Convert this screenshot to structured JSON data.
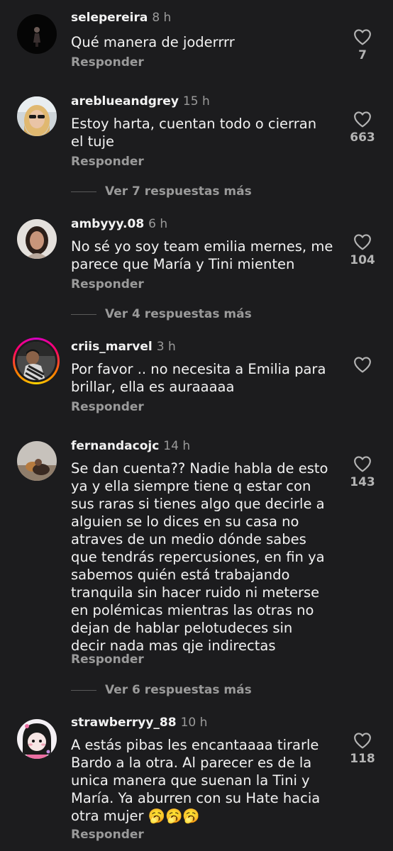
{
  "comments": [
    {
      "username": "selepereira",
      "time": "8 h",
      "lines": [
        "Qué manera de joderrrr"
      ],
      "reply": "Responder",
      "likes": "7"
    },
    {
      "username": "areblueandgrey",
      "time": "15 h",
      "lines": [
        "Estoy harta, cuentan todo o cierran",
        "el tuje"
      ],
      "reply": "Responder",
      "likes": "663",
      "more_replies": "Ver 7 respuestas más"
    },
    {
      "username": "ambyyy.08",
      "time": "6 h",
      "lines": [
        "No sé yo soy team emilia mernes, me",
        "parece que María y Tini mienten"
      ],
      "reply": "Responder",
      "likes": "104",
      "more_replies": "Ver 4 respuestas más"
    },
    {
      "username": "criis_marvel",
      "time": "3 h",
      "lines": [
        "Por favor .. no necesita a Emilia para",
        "brillar, ella es auraaaaa"
      ],
      "reply": "Responder",
      "likes": ""
    },
    {
      "username": "fernandacojc",
      "time": "14 h",
      "lines": [
        "Se dan cuenta?? Nadie habla de esto",
        "ya y ella siempre tiene q estar con",
        "sus raras si tienes algo que decirle a",
        "alguien se lo dices en su casa no",
        "atraves de un medio dónde sabes",
        "que tendrás repercusiones, en fin ya",
        "sabemos quién está trabajando",
        "tranquila sin hacer ruido ni meterse",
        "en polémicas mientras las otras no",
        "dejan de hablar pelotudeces sin",
        "decir nada mas qje indirectas"
      ],
      "reply": "Responder",
      "likes": "143",
      "more_replies": "Ver 6 respuestas más"
    },
    {
      "username": "strawberryy_88",
      "time": "10 h",
      "lines": [
        "A estás pibas les encantaaaa tirarle",
        "Bardo a la otra. Al parecer es de la",
        "unica manera que suenan la Tini y",
        "María. Ya aburren con su Hate hacia",
        "otra mujer 🥱🥱🥱"
      ],
      "reply": "Responder",
      "likes": "118"
    }
  ],
  "icons": {
    "like": "heart-outline-icon"
  },
  "colors": {
    "background": "#1c1c1e",
    "primary_text": "#f2f2f2",
    "secondary_text": "#9a9a9a"
  }
}
